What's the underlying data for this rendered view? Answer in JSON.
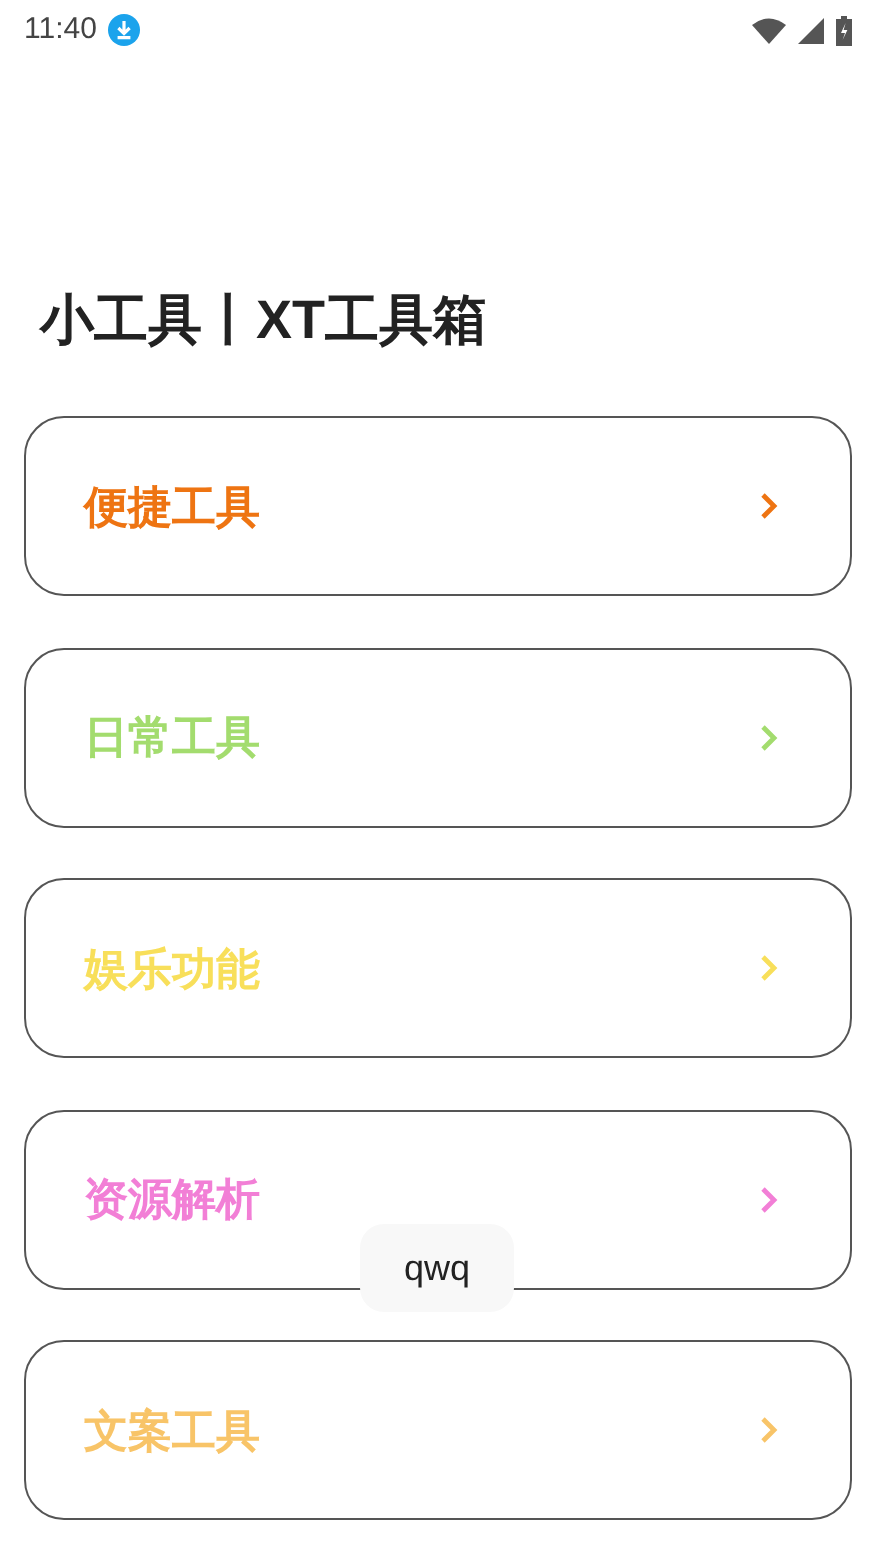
{
  "status_bar": {
    "time": "11:40"
  },
  "title": "小工具丨XT工具箱",
  "menu": [
    {
      "label": "便捷工具",
      "color": "#ee7412"
    },
    {
      "label": "日常工具",
      "color": "#a3dc6e"
    },
    {
      "label": "娱乐功能",
      "color": "#f8df5a"
    },
    {
      "label": "资源解析",
      "color": "#f27fd6"
    },
    {
      "label": "文案工具",
      "color": "#f8c468"
    }
  ],
  "toast": "qwq"
}
